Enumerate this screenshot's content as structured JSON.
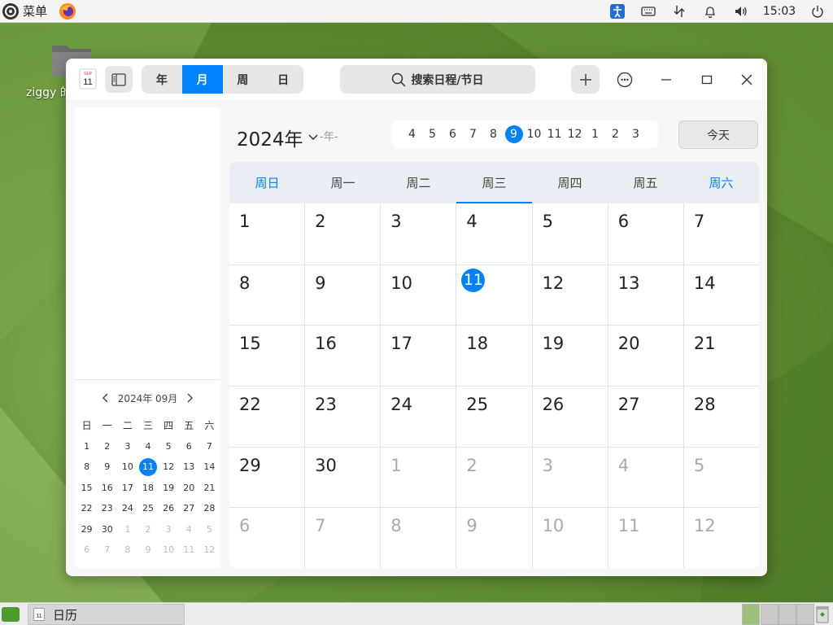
{
  "top_panel": {
    "menu_label": "菜单",
    "clock": "15:03"
  },
  "desktop": {
    "icon_label": "ziggy 的"
  },
  "window": {
    "app_icon": {
      "month": "SEP",
      "day": "11"
    },
    "view_tabs": [
      {
        "label": "年",
        "active": false
      },
      {
        "label": "月",
        "active": true
      },
      {
        "label": "周",
        "active": false
      },
      {
        "label": "日",
        "active": false
      }
    ],
    "search_placeholder": "搜索日程/节日",
    "year_label": "2024年",
    "lunar_label": "-年-",
    "today_button": "今天",
    "months": [
      "4",
      "5",
      "6",
      "7",
      "8",
      "9",
      "10",
      "11",
      "12",
      "1",
      "2",
      "3"
    ],
    "selected_month_index": 5,
    "weekday_headers": [
      "周日",
      "周一",
      "周二",
      "周三",
      "周四",
      "周五",
      "周六"
    ],
    "weeks": [
      [
        {
          "n": "1"
        },
        {
          "n": "2"
        },
        {
          "n": "3"
        },
        {
          "n": "4"
        },
        {
          "n": "5"
        },
        {
          "n": "6"
        },
        {
          "n": "7"
        }
      ],
      [
        {
          "n": "8"
        },
        {
          "n": "9"
        },
        {
          "n": "10"
        },
        {
          "n": "11",
          "today": true
        },
        {
          "n": "12"
        },
        {
          "n": "13"
        },
        {
          "n": "14"
        }
      ],
      [
        {
          "n": "15"
        },
        {
          "n": "16"
        },
        {
          "n": "17"
        },
        {
          "n": "18"
        },
        {
          "n": "19"
        },
        {
          "n": "20"
        },
        {
          "n": "21"
        }
      ],
      [
        {
          "n": "22"
        },
        {
          "n": "23"
        },
        {
          "n": "24"
        },
        {
          "n": "25"
        },
        {
          "n": "26"
        },
        {
          "n": "27"
        },
        {
          "n": "28"
        }
      ],
      [
        {
          "n": "29"
        },
        {
          "n": "30"
        },
        {
          "n": "1",
          "dim": true
        },
        {
          "n": "2",
          "dim": true
        },
        {
          "n": "3",
          "dim": true
        },
        {
          "n": "4",
          "dim": true
        },
        {
          "n": "5",
          "dim": true
        }
      ],
      [
        {
          "n": "6",
          "dim": true
        },
        {
          "n": "7",
          "dim": true
        },
        {
          "n": "8",
          "dim": true
        },
        {
          "n": "9",
          "dim": true
        },
        {
          "n": "10",
          "dim": true
        },
        {
          "n": "11",
          "dim": true
        },
        {
          "n": "12",
          "dim": true
        }
      ]
    ],
    "mini": {
      "title": "2024年 09月",
      "headers": [
        "日",
        "一",
        "二",
        "三",
        "四",
        "五",
        "六"
      ],
      "weeks": [
        [
          {
            "n": "1"
          },
          {
            "n": "2"
          },
          {
            "n": "3"
          },
          {
            "n": "4"
          },
          {
            "n": "5"
          },
          {
            "n": "6"
          },
          {
            "n": "7"
          }
        ],
        [
          {
            "n": "8"
          },
          {
            "n": "9"
          },
          {
            "n": "10"
          },
          {
            "n": "11",
            "today": true
          },
          {
            "n": "12"
          },
          {
            "n": "13"
          },
          {
            "n": "14"
          }
        ],
        [
          {
            "n": "15"
          },
          {
            "n": "16"
          },
          {
            "n": "17"
          },
          {
            "n": "18"
          },
          {
            "n": "19"
          },
          {
            "n": "20"
          },
          {
            "n": "21"
          }
        ],
        [
          {
            "n": "22"
          },
          {
            "n": "23"
          },
          {
            "n": "24"
          },
          {
            "n": "25"
          },
          {
            "n": "26"
          },
          {
            "n": "27"
          },
          {
            "n": "28"
          }
        ],
        [
          {
            "n": "29"
          },
          {
            "n": "30"
          },
          {
            "n": "1",
            "dim": true
          },
          {
            "n": "2",
            "dim": true
          },
          {
            "n": "3",
            "dim": true
          },
          {
            "n": "4",
            "dim": true
          },
          {
            "n": "5",
            "dim": true
          }
        ],
        [
          {
            "n": "6",
            "dim": true
          },
          {
            "n": "7",
            "dim": true
          },
          {
            "n": "8",
            "dim": true
          },
          {
            "n": "9",
            "dim": true
          },
          {
            "n": "10",
            "dim": true
          },
          {
            "n": "11",
            "dim": true
          },
          {
            "n": "12",
            "dim": true
          }
        ]
      ]
    }
  },
  "taskbar": {
    "app_label": "日历",
    "task_icon_day": "11"
  },
  "colors": {
    "accent": "#0081ff",
    "weekend": "#0081ff"
  }
}
